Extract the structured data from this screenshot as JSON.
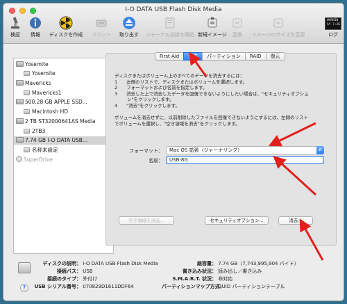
{
  "window": {
    "title": "I-O DATA USB Flash Disk Media"
  },
  "toolbar": {
    "items": [
      {
        "label": "検証",
        "icon": "microscope-icon",
        "disabled": false
      },
      {
        "label": "情報",
        "icon": "info-icon",
        "disabled": false
      },
      {
        "label": "ディスクを作成",
        "icon": "radiation-icon",
        "disabled": false
      },
      {
        "label": "マウント",
        "icon": "mount-icon",
        "disabled": true
      },
      {
        "label": "取り出す",
        "icon": "eject-icon",
        "disabled": false
      },
      {
        "label": "ジャーナル記録を開始",
        "icon": "journal-icon",
        "disabled": true
      },
      {
        "label": "新規イメージ",
        "icon": "new-image-icon",
        "disabled": false
      },
      {
        "label": "変換",
        "icon": "convert-icon",
        "disabled": true
      },
      {
        "label": "イメージのサイズを変更",
        "icon": "resize-image-icon",
        "disabled": true
      }
    ],
    "log_label": "ログ",
    "log_box": "WARNIN\nAY 7:36"
  },
  "sidebar": {
    "items": [
      {
        "label": "Yosemite",
        "kind": "disk",
        "level": 0
      },
      {
        "label": "Yosemite",
        "kind": "volume",
        "level": 1
      },
      {
        "label": "Mavericks",
        "kind": "disk",
        "level": 0
      },
      {
        "label": "Mavericks1",
        "kind": "volume",
        "level": 1
      },
      {
        "label": "500.28 GB APPLE SSD...",
        "kind": "disk",
        "level": 0
      },
      {
        "label": "Macintosh HD",
        "kind": "volume",
        "level": 1
      },
      {
        "label": "2 TB ST32000641AS Media",
        "kind": "disk",
        "level": 0
      },
      {
        "label": "2TB3",
        "kind": "volume",
        "level": 1
      },
      {
        "label": "7.74 GB I-O DATA USB...",
        "kind": "disk",
        "level": 0,
        "selected": true
      },
      {
        "label": "名称未設定",
        "kind": "volume",
        "level": 1
      },
      {
        "label": "SuperDrive",
        "kind": "dvd",
        "level": 0,
        "dim": true
      }
    ]
  },
  "tabs": [
    {
      "label": "First Aid",
      "active": false
    },
    {
      "label": "消去",
      "active": true
    },
    {
      "label": "パーティション",
      "active": false
    },
    {
      "label": "RAID",
      "active": false
    },
    {
      "label": "復元",
      "active": false
    }
  ],
  "erase": {
    "instructions": [
      "ディスクまたはボリューム上のすべてのデータを消去するには：",
      "1　　左側のリストで、ディスクまたはボリュームを選択します。",
      "2　　フォーマットおよび名前を指定します。",
      "3　　消去した上で消去したデータを回復できないようにしたい場合は、\"セキュリティオプショ",
      "ン\"をクリックします。",
      "4　　\"消去\"をクリックします。"
    ],
    "instructions2": [
      "ボリュームを消去せずに、以前削除したファイルを回復できないようにするには、左側のリスト",
      "でボリュームを選択し、\"空き領域を消去\"をクリックします。"
    ],
    "format_label": "フォーマット：",
    "format_value": "Mac OS 拡張（ジャーナリング）",
    "name_label": "名前：",
    "name_value": "USB-8G",
    "erase_free_space_button": "空き領域を消去...",
    "security_options_button": "セキュリティオプション...",
    "erase_button": "消去..."
  },
  "info": {
    "disk_description_label": "ディスクの説明：",
    "disk_description": "I-O DATA USB Flash Disk Media",
    "connection_bus_label": "接続バス：",
    "connection_bus": "USB",
    "connection_type_label": "接続のタイプ：",
    "connection_type": "外付け",
    "usb_serial_label": "USB シリアル番号：",
    "usb_serial": "070829D1611DDF64",
    "total_capacity_label": "総容量：",
    "total_capacity": "7.74 GB（7,743,995,904 バイト）",
    "write_status_label": "書き込み状況：",
    "write_status": "読み出し／書き込み",
    "smart_status_label": "S.M.A.R.T. 状況：",
    "smart_status": "非対応",
    "partition_map_label": "パーティションマップ方式：",
    "partition_map": "GUID パーティションテーブル",
    "help_label": "?"
  },
  "colors": {
    "accent": "#2f7ff1",
    "arrow": "#e3201b",
    "selected_row": "#d3d3d3"
  }
}
